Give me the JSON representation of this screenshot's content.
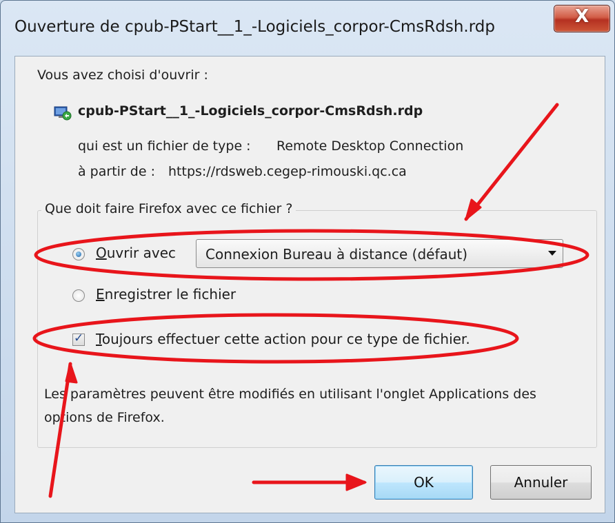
{
  "window": {
    "title": "Ouverture de cpub-PStart__1_-Logiciels_corpor-CmsRdsh.rdp",
    "close_glyph": "X"
  },
  "intro": "Vous avez choisi d'ouvrir :",
  "file": {
    "name": "cpub-PStart__1_-Logiciels_corpor-CmsRdsh.rdp",
    "icon": "remote-desktop-icon",
    "type_label": "qui est un fichier de type :",
    "type_value": "Remote Desktop Connection",
    "source_label": "à partir de :",
    "source_value": "https://rdsweb.cegep-rimouski.qc.ca"
  },
  "group": {
    "legend": "Que doit faire Firefox avec ce fichier ?",
    "open_with": {
      "first_letter": "O",
      "rest": "uvrir avec",
      "selected": true
    },
    "app_select": {
      "value": "Connexion Bureau à distance (défaut)"
    },
    "save_file": {
      "first_letter": "E",
      "rest": "nregistrer le fichier",
      "selected": false
    },
    "always": {
      "first_letter": "T",
      "rest": "oujours effectuer cette action pour ce type de fichier.",
      "checked": true,
      "check_glyph": "✓"
    },
    "note_line1": "Les paramètres peuvent être modifiés en utilisant l'onglet Applications des",
    "note_line2": "options de Firefox."
  },
  "buttons": {
    "ok": "OK",
    "cancel": "Annuler"
  },
  "annotation_color": "#e8151b"
}
